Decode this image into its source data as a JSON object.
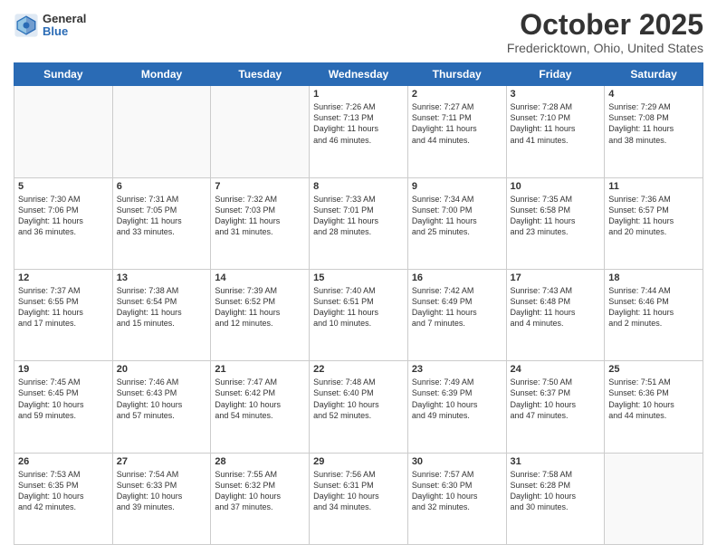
{
  "header": {
    "logo_general": "General",
    "logo_blue": "Blue",
    "month_title": "October 2025",
    "location": "Fredericktown, Ohio, United States"
  },
  "weekdays": [
    "Sunday",
    "Monday",
    "Tuesday",
    "Wednesday",
    "Thursday",
    "Friday",
    "Saturday"
  ],
  "weeks": [
    [
      {
        "day": "",
        "info": ""
      },
      {
        "day": "",
        "info": ""
      },
      {
        "day": "",
        "info": ""
      },
      {
        "day": "1",
        "info": "Sunrise: 7:26 AM\nSunset: 7:13 PM\nDaylight: 11 hours\nand 46 minutes."
      },
      {
        "day": "2",
        "info": "Sunrise: 7:27 AM\nSunset: 7:11 PM\nDaylight: 11 hours\nand 44 minutes."
      },
      {
        "day": "3",
        "info": "Sunrise: 7:28 AM\nSunset: 7:10 PM\nDaylight: 11 hours\nand 41 minutes."
      },
      {
        "day": "4",
        "info": "Sunrise: 7:29 AM\nSunset: 7:08 PM\nDaylight: 11 hours\nand 38 minutes."
      }
    ],
    [
      {
        "day": "5",
        "info": "Sunrise: 7:30 AM\nSunset: 7:06 PM\nDaylight: 11 hours\nand 36 minutes."
      },
      {
        "day": "6",
        "info": "Sunrise: 7:31 AM\nSunset: 7:05 PM\nDaylight: 11 hours\nand 33 minutes."
      },
      {
        "day": "7",
        "info": "Sunrise: 7:32 AM\nSunset: 7:03 PM\nDaylight: 11 hours\nand 31 minutes."
      },
      {
        "day": "8",
        "info": "Sunrise: 7:33 AM\nSunset: 7:01 PM\nDaylight: 11 hours\nand 28 minutes."
      },
      {
        "day": "9",
        "info": "Sunrise: 7:34 AM\nSunset: 7:00 PM\nDaylight: 11 hours\nand 25 minutes."
      },
      {
        "day": "10",
        "info": "Sunrise: 7:35 AM\nSunset: 6:58 PM\nDaylight: 11 hours\nand 23 minutes."
      },
      {
        "day": "11",
        "info": "Sunrise: 7:36 AM\nSunset: 6:57 PM\nDaylight: 11 hours\nand 20 minutes."
      }
    ],
    [
      {
        "day": "12",
        "info": "Sunrise: 7:37 AM\nSunset: 6:55 PM\nDaylight: 11 hours\nand 17 minutes."
      },
      {
        "day": "13",
        "info": "Sunrise: 7:38 AM\nSunset: 6:54 PM\nDaylight: 11 hours\nand 15 minutes."
      },
      {
        "day": "14",
        "info": "Sunrise: 7:39 AM\nSunset: 6:52 PM\nDaylight: 11 hours\nand 12 minutes."
      },
      {
        "day": "15",
        "info": "Sunrise: 7:40 AM\nSunset: 6:51 PM\nDaylight: 11 hours\nand 10 minutes."
      },
      {
        "day": "16",
        "info": "Sunrise: 7:42 AM\nSunset: 6:49 PM\nDaylight: 11 hours\nand 7 minutes."
      },
      {
        "day": "17",
        "info": "Sunrise: 7:43 AM\nSunset: 6:48 PM\nDaylight: 11 hours\nand 4 minutes."
      },
      {
        "day": "18",
        "info": "Sunrise: 7:44 AM\nSunset: 6:46 PM\nDaylight: 11 hours\nand 2 minutes."
      }
    ],
    [
      {
        "day": "19",
        "info": "Sunrise: 7:45 AM\nSunset: 6:45 PM\nDaylight: 10 hours\nand 59 minutes."
      },
      {
        "day": "20",
        "info": "Sunrise: 7:46 AM\nSunset: 6:43 PM\nDaylight: 10 hours\nand 57 minutes."
      },
      {
        "day": "21",
        "info": "Sunrise: 7:47 AM\nSunset: 6:42 PM\nDaylight: 10 hours\nand 54 minutes."
      },
      {
        "day": "22",
        "info": "Sunrise: 7:48 AM\nSunset: 6:40 PM\nDaylight: 10 hours\nand 52 minutes."
      },
      {
        "day": "23",
        "info": "Sunrise: 7:49 AM\nSunset: 6:39 PM\nDaylight: 10 hours\nand 49 minutes."
      },
      {
        "day": "24",
        "info": "Sunrise: 7:50 AM\nSunset: 6:37 PM\nDaylight: 10 hours\nand 47 minutes."
      },
      {
        "day": "25",
        "info": "Sunrise: 7:51 AM\nSunset: 6:36 PM\nDaylight: 10 hours\nand 44 minutes."
      }
    ],
    [
      {
        "day": "26",
        "info": "Sunrise: 7:53 AM\nSunset: 6:35 PM\nDaylight: 10 hours\nand 42 minutes."
      },
      {
        "day": "27",
        "info": "Sunrise: 7:54 AM\nSunset: 6:33 PM\nDaylight: 10 hours\nand 39 minutes."
      },
      {
        "day": "28",
        "info": "Sunrise: 7:55 AM\nSunset: 6:32 PM\nDaylight: 10 hours\nand 37 minutes."
      },
      {
        "day": "29",
        "info": "Sunrise: 7:56 AM\nSunset: 6:31 PM\nDaylight: 10 hours\nand 34 minutes."
      },
      {
        "day": "30",
        "info": "Sunrise: 7:57 AM\nSunset: 6:30 PM\nDaylight: 10 hours\nand 32 minutes."
      },
      {
        "day": "31",
        "info": "Sunrise: 7:58 AM\nSunset: 6:28 PM\nDaylight: 10 hours\nand 30 minutes."
      },
      {
        "day": "",
        "info": ""
      }
    ]
  ]
}
